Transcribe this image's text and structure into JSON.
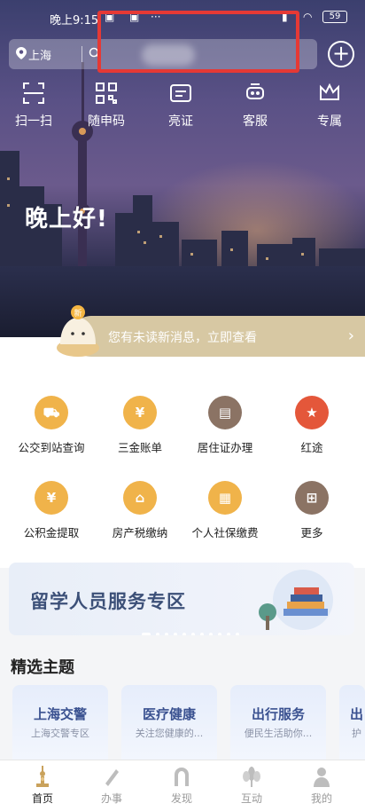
{
  "status_bar": {
    "time": "晚上9:15",
    "battery": "59"
  },
  "header": {
    "location": "上海",
    "search_placeholder": "",
    "add_icon": "plus-circle-icon"
  },
  "quick_actions": [
    {
      "label": "扫一扫",
      "icon": "scan-icon"
    },
    {
      "label": "随申码",
      "icon": "qr-code-icon"
    },
    {
      "label": "亮证",
      "icon": "card-icon"
    },
    {
      "label": "客服",
      "icon": "headset-icon"
    },
    {
      "label": "专属",
      "icon": "crown-icon"
    }
  ],
  "greeting": "晚上好!",
  "notice": {
    "text": "您有未读新消息，立即查看",
    "badge": "新"
  },
  "services": [
    {
      "label": "公交到站查询",
      "icon": "bus-icon",
      "color": "#f0b34a"
    },
    {
      "label": "三金账单",
      "icon": "yen-bill-icon",
      "color": "#f0b34a"
    },
    {
      "label": "居住证办理",
      "icon": "id-card-icon",
      "color": "#8b7364"
    },
    {
      "label": "红途",
      "icon": "red-star-icon",
      "color": "#e4573a"
    },
    {
      "label": "公积金提取",
      "icon": "money-bag-icon",
      "color": "#f0b34a"
    },
    {
      "label": "房产税缴纳",
      "icon": "house-tax-icon",
      "color": "#f0b34a"
    },
    {
      "label": "个人社保缴费",
      "icon": "social-insurance-icon",
      "color": "#f0b34a"
    },
    {
      "label": "更多",
      "icon": "more-grid-icon",
      "color": "#8b7364"
    }
  ],
  "banner": {
    "title": "留学人员服务专区"
  },
  "section_title": "精选主题",
  "topics": [
    {
      "title": "上海交警",
      "subtitle": "上海交警专区"
    },
    {
      "title": "医疗健康",
      "subtitle": "关注您健康的..."
    },
    {
      "title": "出行服务",
      "subtitle": "便民生活助你..."
    },
    {
      "title": "出",
      "subtitle": "护"
    }
  ],
  "bottom_nav": [
    {
      "label": "首页",
      "icon": "home-tower-icon",
      "active": true
    },
    {
      "label": "办事",
      "icon": "pen-icon",
      "active": false
    },
    {
      "label": "发现",
      "icon": "discover-gate-icon",
      "active": false
    },
    {
      "label": "互动",
      "icon": "flower-icon",
      "active": false
    },
    {
      "label": "我的",
      "icon": "person-icon",
      "active": false
    }
  ]
}
